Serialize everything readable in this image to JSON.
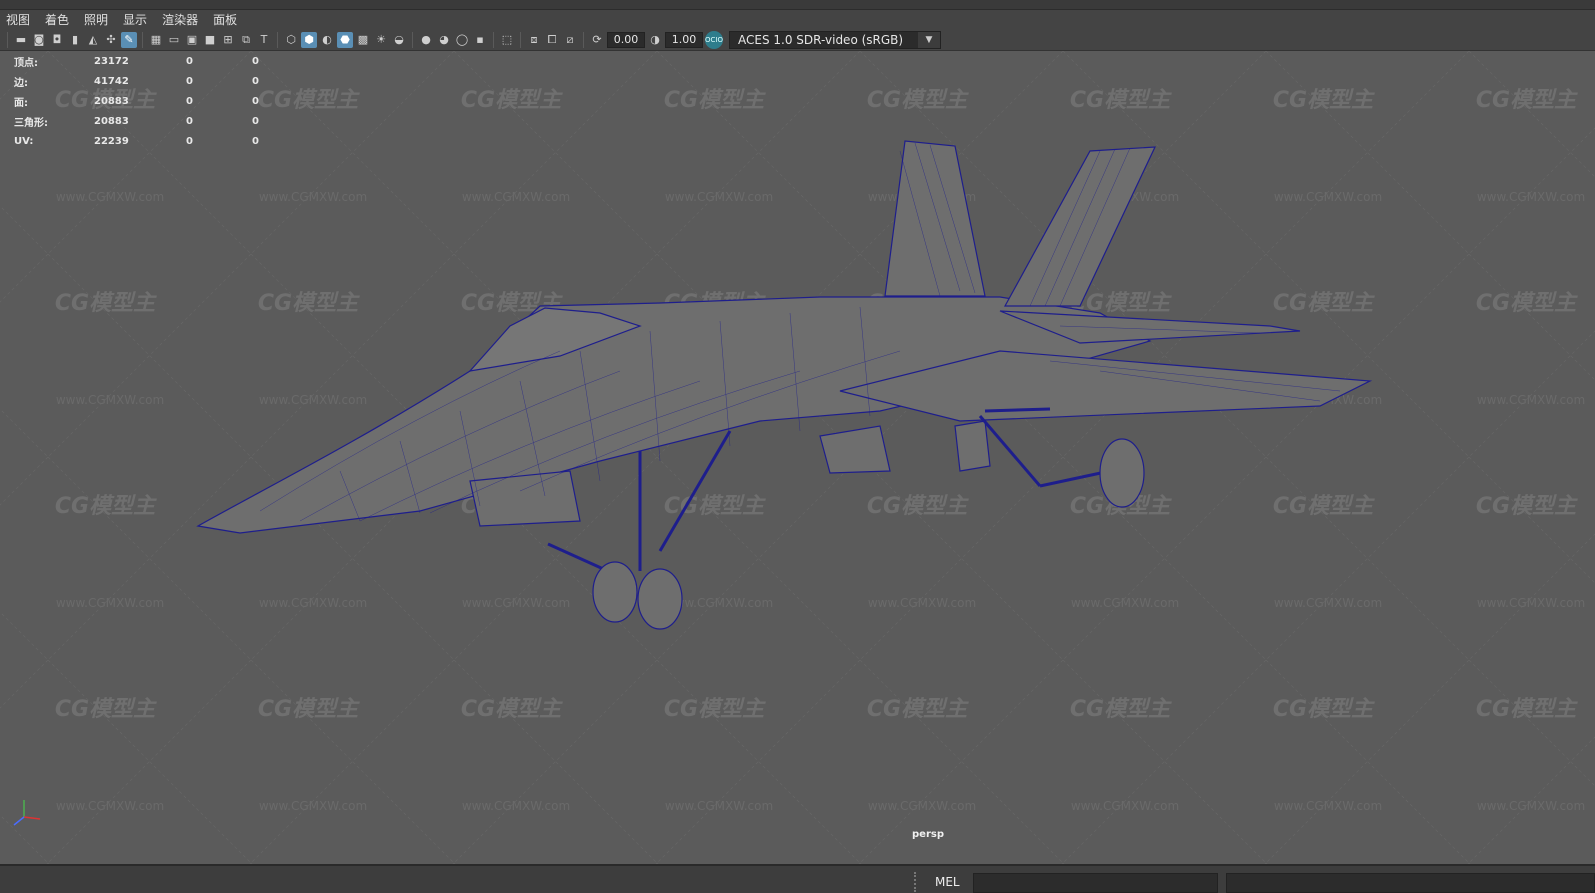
{
  "menu": {
    "items": [
      "视图",
      "着色",
      "照明",
      "显示",
      "渲染器",
      "面板"
    ]
  },
  "toolbar": {
    "exposure_value": "0.00",
    "gamma_value": "1.00",
    "color_space": "ACES 1.0 SDR-video (sRGB)",
    "ocio_badge": "OCIO",
    "icons_group1": [
      "camera-icon",
      "camera-attributes-icon",
      "bookmark-camera-icon",
      "bookmark-icon",
      "image-plane-icon",
      "2d-pan-zoom-icon",
      "grease-pencil-icon"
    ],
    "icons_group2": [
      "grid-icon",
      "film-gate-icon",
      "resolution-gate-icon",
      "gate-mask-icon",
      "field-chart-icon",
      "safe-action-icon",
      "safe-title-icon"
    ],
    "icons_group3": [
      "wireframe-icon",
      "smooth-shade-all-icon",
      "use-default-material-icon",
      "wireframe-on-shaded-icon",
      "textured-icon",
      "use-all-lights-icon",
      "shadows-icon"
    ],
    "icons_group4": [
      "screen-space-ao-icon",
      "motion-blur-icon",
      "multisample-aa-icon",
      "depth-of-field-icon"
    ],
    "icons_group5": [
      "isolate-select-icon"
    ],
    "icons_group6": [
      "xray-icon",
      "xray-active-components-icon",
      "xray-joints-icon"
    ],
    "icons_group7": [
      "exposure-icon",
      "gamma-icon",
      "color-management-icon"
    ]
  },
  "stats": [
    {
      "label": "顶点:",
      "v1": "23172",
      "v2": "0",
      "v3": "0"
    },
    {
      "label": "边:",
      "v1": "41742",
      "v2": "0",
      "v3": "0"
    },
    {
      "label": "面:",
      "v1": "20883",
      "v2": "0",
      "v3": "0"
    },
    {
      "label": "三角形:",
      "v1": "20883",
      "v2": "0",
      "v3": "0"
    },
    {
      "label": "UV:",
      "v1": "22239",
      "v2": "0",
      "v3": "0"
    }
  ],
  "viewport": {
    "camera_label": "persp",
    "background_color": "#5b5b5b",
    "wire_color": "#1e1e8c"
  },
  "watermark": {
    "logo_text": "CG模型主",
    "url_text": "www.CGMXW.com"
  },
  "statusbar": {
    "mel_label": "MEL"
  }
}
